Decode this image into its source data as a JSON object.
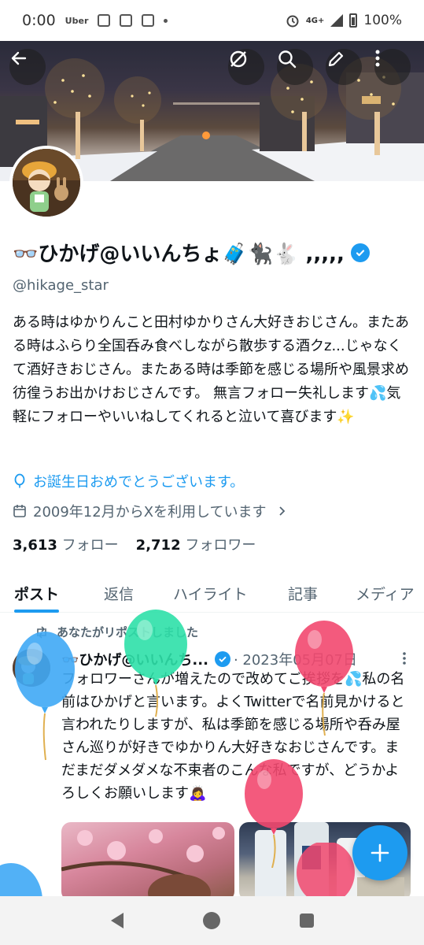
{
  "status_bar": {
    "time": "0:00",
    "app_label": "Uber",
    "network": "4G+",
    "battery": "100%"
  },
  "profile": {
    "display_name": "👓ひかげ@いいんちょ🧳🐈‍⬛🐇 ,,,,,",
    "handle": "@hikage_star",
    "bio": "ある時はゆかりんこと田村ゆかりさん大好きおじさん。またある時はふらり全国呑み食べしながら散歩する酒クz...じゃなくて酒好きおじさん。またある時は季節を感じる場所や風景求め彷徨うお出かけおじさんです。 無言フォロー失礼します💦気軽にフォローやいいねしてくれると泣いて喜びます✨",
    "birthday_text": "お誕生日おめでとうございます。",
    "joined_text": "2009年12月からXを利用しています",
    "following_count": "3,613",
    "following_label": "フォロー",
    "followers_count": "2,712",
    "followers_label": "フォロワー"
  },
  "tabs": [
    {
      "label": "ポスト",
      "active": true
    },
    {
      "label": "返信",
      "active": false
    },
    {
      "label": "ハイライト",
      "active": false
    },
    {
      "label": "記事",
      "active": false
    },
    {
      "label": "メディア",
      "active": false
    }
  ],
  "post": {
    "repost_label": "あなたがリポストしました",
    "author_name": "👓ひかげ@いいんち...",
    "date": "· 2023年05月07日",
    "text": "フォロワーさんが増えたので改めてご挨拶を💦私の名前はひかげと言います。よくTwitterで名前見かけると言われたりしますが、私は季節を感じる場所や呑み屋さん巡りが好きでゆかりん大好きなおじさんです。まだまだダメダメな不束者のこんな私ですが、どうかよろしくお願いします🙇‍♀️"
  },
  "icons": {
    "header": [
      "back-arrow-icon",
      "hide-icon",
      "search-icon",
      "edit-icon",
      "more-vertical-icon"
    ],
    "nav": [
      "nav-back-icon",
      "nav-home-icon",
      "nav-recents-icon"
    ],
    "fab": "plus-icon"
  },
  "colors": {
    "accent": "#1d9bf0",
    "text": "#0f1419",
    "muted": "#536471",
    "balloon_blue": "#3fa9f5",
    "balloon_green": "#2ee0a8",
    "balloon_pink": "#f2486f"
  }
}
